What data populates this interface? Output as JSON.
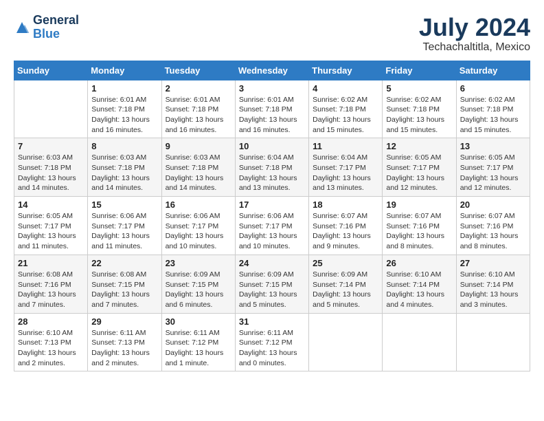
{
  "logo": {
    "line1": "General",
    "line2": "Blue"
  },
  "title": {
    "month_year": "July 2024",
    "location": "Techachaltitla, Mexico"
  },
  "days_of_week": [
    "Sunday",
    "Monday",
    "Tuesday",
    "Wednesday",
    "Thursday",
    "Friday",
    "Saturday"
  ],
  "weeks": [
    [
      {
        "day": "",
        "sunrise": "",
        "sunset": "",
        "daylight": ""
      },
      {
        "day": "1",
        "sunrise": "Sunrise: 6:01 AM",
        "sunset": "Sunset: 7:18 PM",
        "daylight": "Daylight: 13 hours and 16 minutes."
      },
      {
        "day": "2",
        "sunrise": "Sunrise: 6:01 AM",
        "sunset": "Sunset: 7:18 PM",
        "daylight": "Daylight: 13 hours and 16 minutes."
      },
      {
        "day": "3",
        "sunrise": "Sunrise: 6:01 AM",
        "sunset": "Sunset: 7:18 PM",
        "daylight": "Daylight: 13 hours and 16 minutes."
      },
      {
        "day": "4",
        "sunrise": "Sunrise: 6:02 AM",
        "sunset": "Sunset: 7:18 PM",
        "daylight": "Daylight: 13 hours and 15 minutes."
      },
      {
        "day": "5",
        "sunrise": "Sunrise: 6:02 AM",
        "sunset": "Sunset: 7:18 PM",
        "daylight": "Daylight: 13 hours and 15 minutes."
      },
      {
        "day": "6",
        "sunrise": "Sunrise: 6:02 AM",
        "sunset": "Sunset: 7:18 PM",
        "daylight": "Daylight: 13 hours and 15 minutes."
      }
    ],
    [
      {
        "day": "7",
        "sunrise": "Sunrise: 6:03 AM",
        "sunset": "Sunset: 7:18 PM",
        "daylight": "Daylight: 13 hours and 14 minutes."
      },
      {
        "day": "8",
        "sunrise": "Sunrise: 6:03 AM",
        "sunset": "Sunset: 7:18 PM",
        "daylight": "Daylight: 13 hours and 14 minutes."
      },
      {
        "day": "9",
        "sunrise": "Sunrise: 6:03 AM",
        "sunset": "Sunset: 7:18 PM",
        "daylight": "Daylight: 13 hours and 14 minutes."
      },
      {
        "day": "10",
        "sunrise": "Sunrise: 6:04 AM",
        "sunset": "Sunset: 7:18 PM",
        "daylight": "Daylight: 13 hours and 13 minutes."
      },
      {
        "day": "11",
        "sunrise": "Sunrise: 6:04 AM",
        "sunset": "Sunset: 7:17 PM",
        "daylight": "Daylight: 13 hours and 13 minutes."
      },
      {
        "day": "12",
        "sunrise": "Sunrise: 6:05 AM",
        "sunset": "Sunset: 7:17 PM",
        "daylight": "Daylight: 13 hours and 12 minutes."
      },
      {
        "day": "13",
        "sunrise": "Sunrise: 6:05 AM",
        "sunset": "Sunset: 7:17 PM",
        "daylight": "Daylight: 13 hours and 12 minutes."
      }
    ],
    [
      {
        "day": "14",
        "sunrise": "Sunrise: 6:05 AM",
        "sunset": "Sunset: 7:17 PM",
        "daylight": "Daylight: 13 hours and 11 minutes."
      },
      {
        "day": "15",
        "sunrise": "Sunrise: 6:06 AM",
        "sunset": "Sunset: 7:17 PM",
        "daylight": "Daylight: 13 hours and 11 minutes."
      },
      {
        "day": "16",
        "sunrise": "Sunrise: 6:06 AM",
        "sunset": "Sunset: 7:17 PM",
        "daylight": "Daylight: 13 hours and 10 minutes."
      },
      {
        "day": "17",
        "sunrise": "Sunrise: 6:06 AM",
        "sunset": "Sunset: 7:17 PM",
        "daylight": "Daylight: 13 hours and 10 minutes."
      },
      {
        "day": "18",
        "sunrise": "Sunrise: 6:07 AM",
        "sunset": "Sunset: 7:16 PM",
        "daylight": "Daylight: 13 hours and 9 minutes."
      },
      {
        "day": "19",
        "sunrise": "Sunrise: 6:07 AM",
        "sunset": "Sunset: 7:16 PM",
        "daylight": "Daylight: 13 hours and 8 minutes."
      },
      {
        "day": "20",
        "sunrise": "Sunrise: 6:07 AM",
        "sunset": "Sunset: 7:16 PM",
        "daylight": "Daylight: 13 hours and 8 minutes."
      }
    ],
    [
      {
        "day": "21",
        "sunrise": "Sunrise: 6:08 AM",
        "sunset": "Sunset: 7:16 PM",
        "daylight": "Daylight: 13 hours and 7 minutes."
      },
      {
        "day": "22",
        "sunrise": "Sunrise: 6:08 AM",
        "sunset": "Sunset: 7:15 PM",
        "daylight": "Daylight: 13 hours and 7 minutes."
      },
      {
        "day": "23",
        "sunrise": "Sunrise: 6:09 AM",
        "sunset": "Sunset: 7:15 PM",
        "daylight": "Daylight: 13 hours and 6 minutes."
      },
      {
        "day": "24",
        "sunrise": "Sunrise: 6:09 AM",
        "sunset": "Sunset: 7:15 PM",
        "daylight": "Daylight: 13 hours and 5 minutes."
      },
      {
        "day": "25",
        "sunrise": "Sunrise: 6:09 AM",
        "sunset": "Sunset: 7:14 PM",
        "daylight": "Daylight: 13 hours and 5 minutes."
      },
      {
        "day": "26",
        "sunrise": "Sunrise: 6:10 AM",
        "sunset": "Sunset: 7:14 PM",
        "daylight": "Daylight: 13 hours and 4 minutes."
      },
      {
        "day": "27",
        "sunrise": "Sunrise: 6:10 AM",
        "sunset": "Sunset: 7:14 PM",
        "daylight": "Daylight: 13 hours and 3 minutes."
      }
    ],
    [
      {
        "day": "28",
        "sunrise": "Sunrise: 6:10 AM",
        "sunset": "Sunset: 7:13 PM",
        "daylight": "Daylight: 13 hours and 2 minutes."
      },
      {
        "day": "29",
        "sunrise": "Sunrise: 6:11 AM",
        "sunset": "Sunset: 7:13 PM",
        "daylight": "Daylight: 13 hours and 2 minutes."
      },
      {
        "day": "30",
        "sunrise": "Sunrise: 6:11 AM",
        "sunset": "Sunset: 7:12 PM",
        "daylight": "Daylight: 13 hours and 1 minute."
      },
      {
        "day": "31",
        "sunrise": "Sunrise: 6:11 AM",
        "sunset": "Sunset: 7:12 PM",
        "daylight": "Daylight: 13 hours and 0 minutes."
      },
      {
        "day": "",
        "sunrise": "",
        "sunset": "",
        "daylight": ""
      },
      {
        "day": "",
        "sunrise": "",
        "sunset": "",
        "daylight": ""
      },
      {
        "day": "",
        "sunrise": "",
        "sunset": "",
        "daylight": ""
      }
    ]
  ]
}
